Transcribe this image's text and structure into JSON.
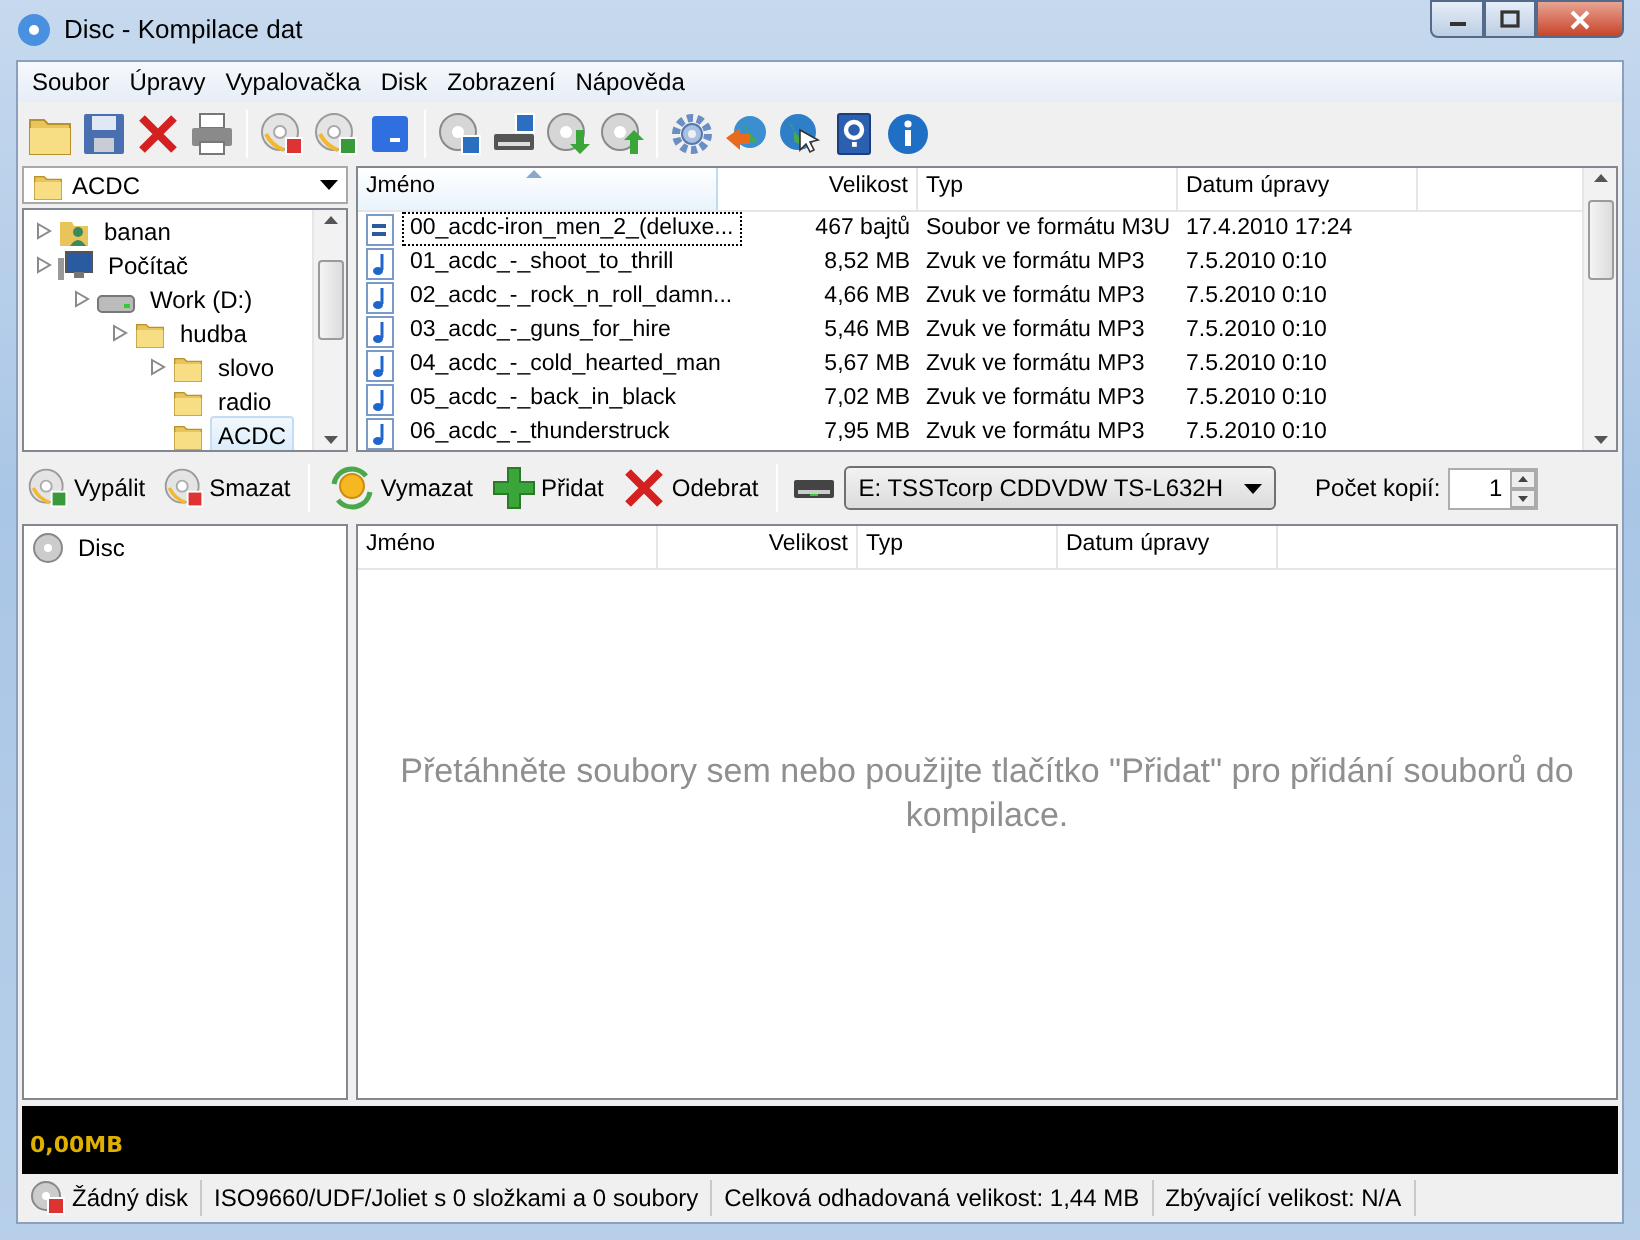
{
  "window": {
    "title": "Disc - Kompilace dat"
  },
  "menu": [
    {
      "label": "Soubor"
    },
    {
      "label": "Úpravy"
    },
    {
      "label": "Vypalovačka"
    },
    {
      "label": "Disk"
    },
    {
      "label": "Zobrazení"
    },
    {
      "label": "Nápověda"
    }
  ],
  "folder_combo": {
    "value": "ACDC"
  },
  "folder_tree": [
    {
      "label": "banan",
      "kind": "user",
      "expander": true,
      "selected": false
    },
    {
      "label": "Počítač",
      "kind": "computer",
      "expander": true,
      "selected": false,
      "children": [
        {
          "label": "Work (D:)",
          "kind": "drive",
          "expander": true,
          "selected": false,
          "children": [
            {
              "label": "hudba",
              "kind": "folder",
              "expander": true,
              "selected": false,
              "children": [
                {
                  "label": "slovo",
                  "kind": "folder",
                  "expander": true,
                  "selected": false
                },
                {
                  "label": "radio",
                  "kind": "folder",
                  "expander": false,
                  "selected": false
                },
                {
                  "label": "ACDC",
                  "kind": "folder",
                  "expander": false,
                  "selected": true
                }
              ]
            }
          ]
        }
      ]
    }
  ],
  "file_list": {
    "columns": [
      {
        "label": "Jméno",
        "sorted": true
      },
      {
        "label": "Velikost",
        "sorted": false
      },
      {
        "label": "Typ",
        "sorted": false
      },
      {
        "label": "Datum úpravy",
        "sorted": false
      }
    ],
    "rows": [
      {
        "kind": "playlist",
        "selected": true,
        "cells": [
          "00_acdc-iron_men_2_(deluxe...",
          "467 bajtů",
          "Soubor ve formátu M3U",
          "17.4.2010 17:24"
        ]
      },
      {
        "kind": "audio",
        "selected": false,
        "cells": [
          "01_acdc_-_shoot_to_thrill",
          "8,52 MB",
          "Zvuk ve formátu MP3",
          "7.5.2010 0:10"
        ]
      },
      {
        "kind": "audio",
        "selected": false,
        "cells": [
          "02_acdc_-_rock_n_roll_damn...",
          "4,66 MB",
          "Zvuk ve formátu MP3",
          "7.5.2010 0:10"
        ]
      },
      {
        "kind": "audio",
        "selected": false,
        "cells": [
          "03_acdc_-_guns_for_hire",
          "5,46 MB",
          "Zvuk ve formátu MP3",
          "7.5.2010 0:10"
        ]
      },
      {
        "kind": "audio",
        "selected": false,
        "cells": [
          "04_acdc_-_cold_hearted_man",
          "5,67 MB",
          "Zvuk ve formátu MP3",
          "7.5.2010 0:10"
        ]
      },
      {
        "kind": "audio",
        "selected": false,
        "cells": [
          "05_acdc_-_back_in_black",
          "7,02 MB",
          "Zvuk ve formátu MP3",
          "7.5.2010 0:10"
        ]
      },
      {
        "kind": "audio",
        "selected": false,
        "cells": [
          "06_acdc_-_thunderstruck",
          "7,95 MB",
          "Zvuk ve formátu MP3",
          "7.5.2010 0:10"
        ]
      }
    ]
  },
  "compilation_toolbar": {
    "buttons": [
      {
        "label": "Vypálit",
        "kind": "burn"
      },
      {
        "label": "Smazat",
        "kind": "erase"
      },
      {
        "label": "Vymazat",
        "kind": "clear"
      },
      {
        "label": "Přidat",
        "kind": "add"
      },
      {
        "label": "Odebrat",
        "kind": "remove"
      }
    ],
    "drive": {
      "value": "E: TSSTcorp CDDVDW TS-L632H"
    },
    "copies": {
      "label": "Počet kopií:",
      "value": "1"
    }
  },
  "compilation_tree": [
    {
      "label": "Disc",
      "selected": false
    }
  ],
  "compilation_list": {
    "columns": [
      {
        "label": "Jméno",
        "sorted": false
      },
      {
        "label": "Velikost",
        "sorted": false
      },
      {
        "label": "Typ",
        "sorted": false
      },
      {
        "label": "Datum úpravy",
        "sorted": false
      }
    ],
    "empty_message": "Přetáhněte soubory sem nebo použijte tlačítko \"Přidat\" pro přidání souborů do kompilace."
  },
  "capacity_bar": {
    "reading": "0,00MB",
    "level": 0
  },
  "status_bar": [
    {
      "kind": "no-disc",
      "text": "Žádný disk"
    },
    {
      "kind": "plain",
      "text": "ISO9660/UDF/Joliet s 0 složkami a 0 soubory"
    },
    {
      "kind": "plain",
      "text": "Celková odhadovaná velikost: 1,44 MB"
    },
    {
      "kind": "plain",
      "text": "Zbývající velikost: N/A"
    }
  ]
}
